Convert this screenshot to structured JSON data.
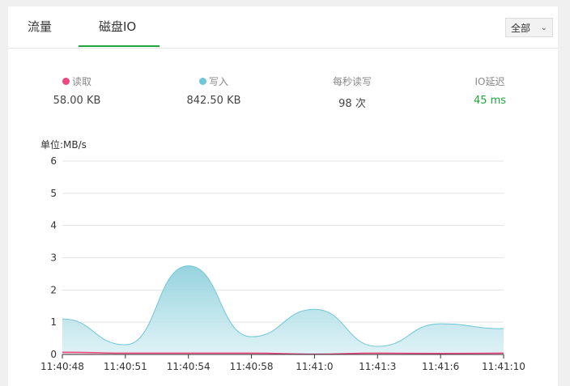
{
  "tabs": [
    {
      "label": "流量",
      "active": false
    },
    {
      "label": "磁盘IO",
      "active": true
    }
  ],
  "filter": {
    "selected": "全部"
  },
  "stats": {
    "read": {
      "label": "读取",
      "value": "58.00 KB",
      "color": "#f0457d"
    },
    "write": {
      "label": "写入",
      "value": "842.50 KB",
      "color": "#6ec6d6"
    },
    "iops": {
      "label": "每秒读写",
      "value": "98 次"
    },
    "latency": {
      "label": "IO延迟",
      "value": "45 ms",
      "color": "#20a53a"
    }
  },
  "chart_data": {
    "type": "area",
    "ylabel": "单位:MB/s",
    "ylim": [
      0,
      6
    ],
    "yticks": [
      0,
      1,
      2,
      3,
      4,
      5,
      6
    ],
    "x": [
      "11:40:48",
      "11:40:51",
      "11:40:54",
      "11:40:58",
      "11:41:0",
      "11:41:3",
      "11:41:6",
      "11:41:10"
    ],
    "grid": true,
    "series": [
      {
        "name": "读取",
        "color": "#f0457d",
        "values": [
          0.07,
          0.04,
          0.04,
          0.04,
          0.01,
          0.04,
          0.03,
          0.04
        ]
      },
      {
        "name": "写入",
        "color": "#6ec6d6",
        "values": [
          1.1,
          0.3,
          2.75,
          0.55,
          1.4,
          0.25,
          0.95,
          0.8
        ]
      }
    ]
  }
}
